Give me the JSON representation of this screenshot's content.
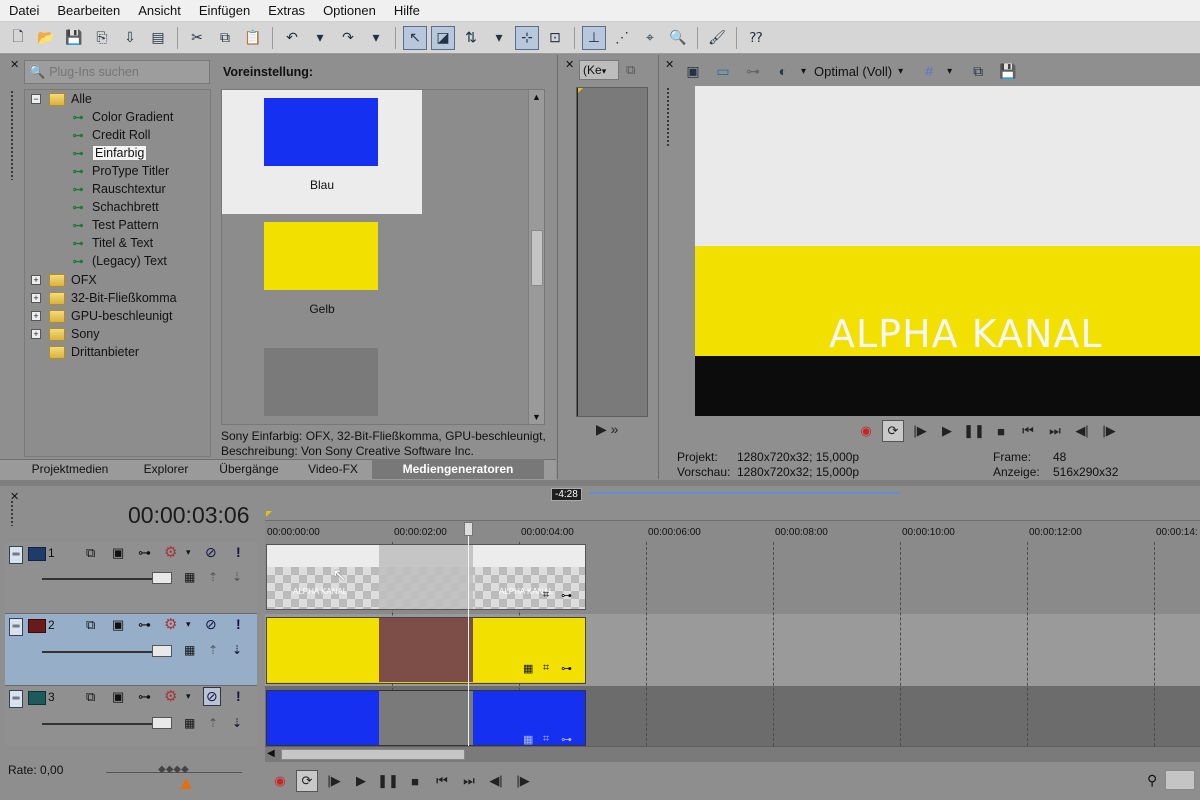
{
  "menu": [
    "Datei",
    "Bearbeiten",
    "Ansicht",
    "Einfügen",
    "Extras",
    "Optionen",
    "Hilfe"
  ],
  "plugins": {
    "search_placeholder": "Plug-Ins suchen",
    "tree": {
      "root": "Alle",
      "children": [
        "Color Gradient",
        "Credit Roll",
        "Einfarbig",
        "ProType Titler",
        "Rauschtextur",
        "Schachbrett",
        "Test Pattern",
        "Titel & Text",
        "(Legacy) Text"
      ],
      "folders": [
        "OFX",
        "32-Bit-Fließkomma",
        "GPU-beschleunigt",
        "Sony",
        "Drittanbieter"
      ],
      "selected": "Einfarbig"
    }
  },
  "presets": {
    "header": "Voreinstellung:",
    "items": [
      {
        "label": "Blau",
        "color": "#1530f0"
      },
      {
        "label": "Gelb",
        "color": "#f2e000"
      },
      {
        "label": "",
        "color": "#7a7a7a"
      }
    ],
    "description_line1": "Sony Einfarbig: OFX, 32-Bit-Fließkomma, GPU-beschleunigt,",
    "description_line2": "Beschreibung: Von Sony Creative Software Inc."
  },
  "tabs": [
    "Projektmedien",
    "Explorer",
    "Übergänge",
    "Video-FX",
    "Mediengeneratoren"
  ],
  "trimmer": {
    "dropdown": "(Ke",
    "arrow_labels": "▶ »"
  },
  "preview": {
    "quality": "Optimal (Voll)",
    "overlay_text": "ALPHA KANAL",
    "projekt_label": "Projekt:",
    "projekt_value": "1280x720x32; 15,000p",
    "vorschau_label": "Vorschau:",
    "vorschau_value": "1280x720x32; 15,000p",
    "frame_label": "Frame:",
    "frame_value": "48",
    "anzeige_label": "Anzeige:",
    "anzeige_value": "516x290x32"
  },
  "timeline": {
    "timecode": "00:00:03:06",
    "region_marker": "-4:28",
    "ruler": [
      "00:00:00:00",
      "00:00:02:00",
      "00:00:04:00",
      "00:00:06:00",
      "00:00:08:00",
      "00:00:10:00",
      "00:00:12:00",
      "00:00:14:"
    ],
    "tracks": [
      "1",
      "2",
      "3"
    ],
    "clip_text": "ALPHA KANAL",
    "rate": "Rate: 0,00"
  },
  "colors": {
    "blue": "#1530f0",
    "yellow": "#f2e000",
    "maroon": "#7d4d48",
    "selected_track": "#97aec8"
  }
}
